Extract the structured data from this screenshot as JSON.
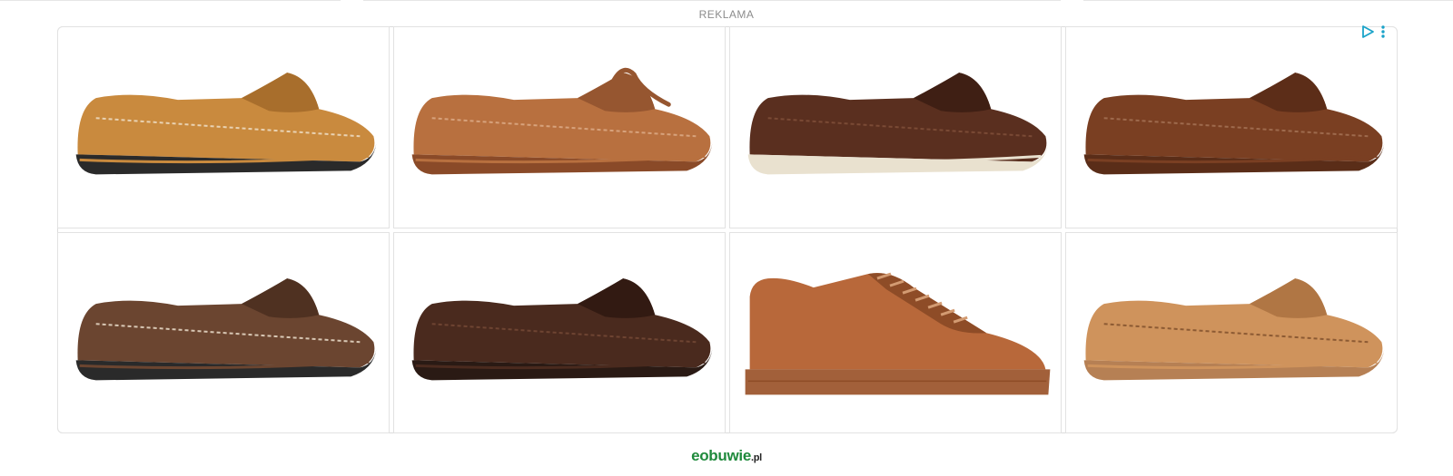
{
  "ad_label": "REKLAMA",
  "brand": {
    "name": "eobuwie",
    "tld": ".pl"
  },
  "colors": {
    "accent": "#1aa3c9",
    "brand": "#1f8a3c"
  },
  "products": [
    {
      "type": "penny-loafer",
      "upper": "#c98a3e",
      "dark": "#a86e2c",
      "sole": "#2a2a2a",
      "midsole": "#c98a3e",
      "stitch": "#e9d2b2"
    },
    {
      "type": "boat-moccasin",
      "upper": "#b8703f",
      "dark": "#965630",
      "sole": "#8a4a28",
      "midsole": "#b8703f",
      "stitch": "#d7a27c"
    },
    {
      "type": "suede-loafer",
      "upper": "#5a2f1f",
      "dark": "#3f1f14",
      "sole": "#e9e1cf",
      "midsole": "#e9e1cf",
      "stitch": "#7a4a35"
    },
    {
      "type": "penny-loafer",
      "upper": "#7a3f22",
      "dark": "#5c2d18",
      "sole": "#5a2d18",
      "midsole": "#7a3f22",
      "stitch": "#9e6a4d"
    },
    {
      "type": "penny-loafer",
      "upper": "#6b4530",
      "dark": "#4f3121",
      "sole": "#2a2a2a",
      "midsole": "#6b4530",
      "stitch": "#d8c7b4"
    },
    {
      "type": "driver",
      "upper": "#4a2a1e",
      "dark": "#321a12",
      "sole": "#2a1a14",
      "midsole": "#4a2a1e",
      "stitch": "#6e4432"
    },
    {
      "type": "sneaker",
      "upper": "#b8683a",
      "dark": "#8e4c27",
      "sole": "#a2603a",
      "midsole": "#a2603a",
      "stitch": "#d39b72"
    },
    {
      "type": "moccasin",
      "upper": "#cf935c",
      "dark": "#b07644",
      "sole": "#b68054",
      "midsole": "#cf935c",
      "stitch": "#8c5a33"
    }
  ]
}
